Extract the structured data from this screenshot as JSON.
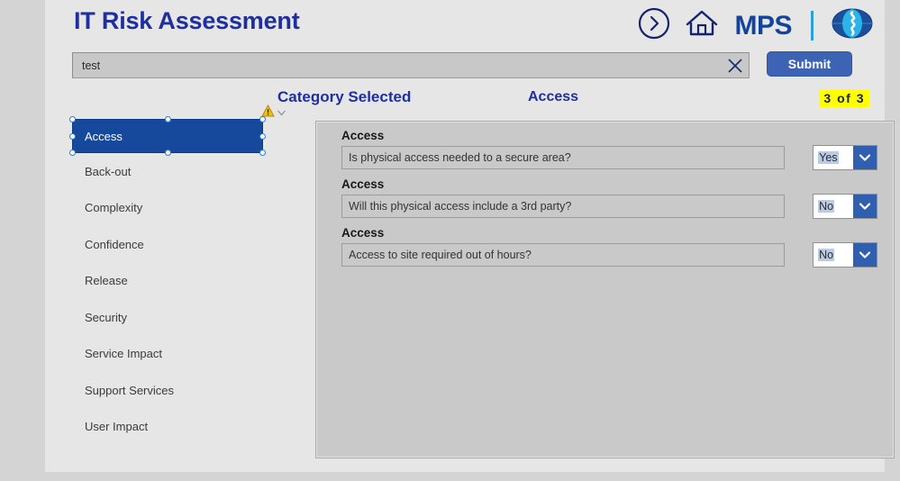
{
  "header": {
    "app_title": "IT Risk Assessment",
    "brand_text": "MPS",
    "icons": {
      "forward_arrow": "arrow-right-circle-icon",
      "home": "home-icon",
      "globe": "mps-globe-logo"
    },
    "colors": {
      "title_blue": "#1f2f9e",
      "brand_blue": "#13449a",
      "accent_cyan": "#2f9fd6"
    }
  },
  "search": {
    "value": "test",
    "placeholder": "",
    "clear_icon": "close-x-icon",
    "submit_label": "Submit",
    "submit_color": "#3d64b4"
  },
  "sub_header": {
    "category_label": "Category Selected",
    "category_value": "Access",
    "counter": "3  of  3",
    "counter_highlight": "#ffff00",
    "warning_icon": "warning-triangle-icon",
    "chevron_icon": "chevron-down-icon"
  },
  "sidebar": {
    "selected_index": 0,
    "selected_color": "#16499c",
    "items": [
      {
        "label": "Access"
      },
      {
        "label": "Back-out"
      },
      {
        "label": "Complexity"
      },
      {
        "label": "Confidence"
      },
      {
        "label": "Release"
      },
      {
        "label": "Security"
      },
      {
        "label": "Service Impact"
      },
      {
        "label": "Support Services"
      },
      {
        "label": "User Impact"
      }
    ]
  },
  "main": {
    "questions": [
      {
        "category": "Access",
        "text": "Is physical access needed to a secure area?",
        "answer": "Yes"
      },
      {
        "category": "Access",
        "text": "Will this physical access include a 3rd party?",
        "answer": "No"
      },
      {
        "category": "Access",
        "text": "Access to site required out of hours?",
        "answer": "No"
      }
    ],
    "dropdown_arrow_icon": "chevron-down-icon"
  }
}
